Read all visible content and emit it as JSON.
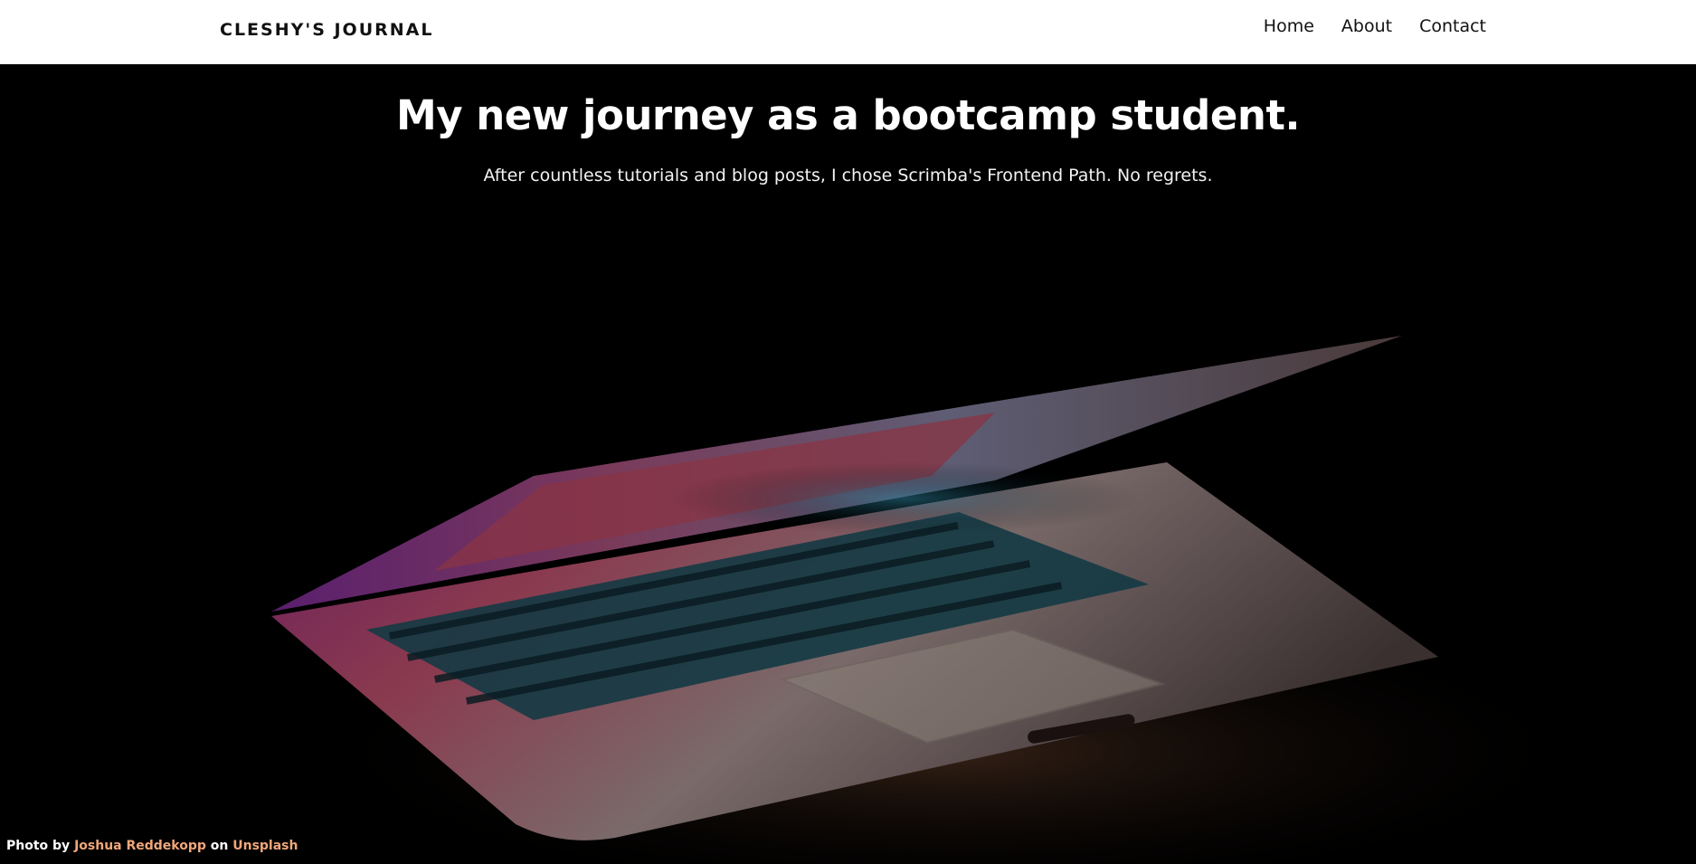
{
  "header": {
    "logo": "CLESHY'S JOURNAL",
    "nav": [
      "Home",
      "About",
      "Contact"
    ]
  },
  "hero": {
    "title": "My new journey as a bootcamp student.",
    "subtitle": "After countless tutorials and blog posts, I chose Scrimba's Frontend Path. No regrets.",
    "image": "laptop-photo"
  },
  "credit": {
    "prefix": "Photo by",
    "author": "Joshua Reddekopp",
    "middle": "on",
    "source": "Unsplash"
  },
  "colors": {
    "header_bg": "#ffffff",
    "hero_bg": "#000000",
    "credit_link": "#f0a77a"
  }
}
